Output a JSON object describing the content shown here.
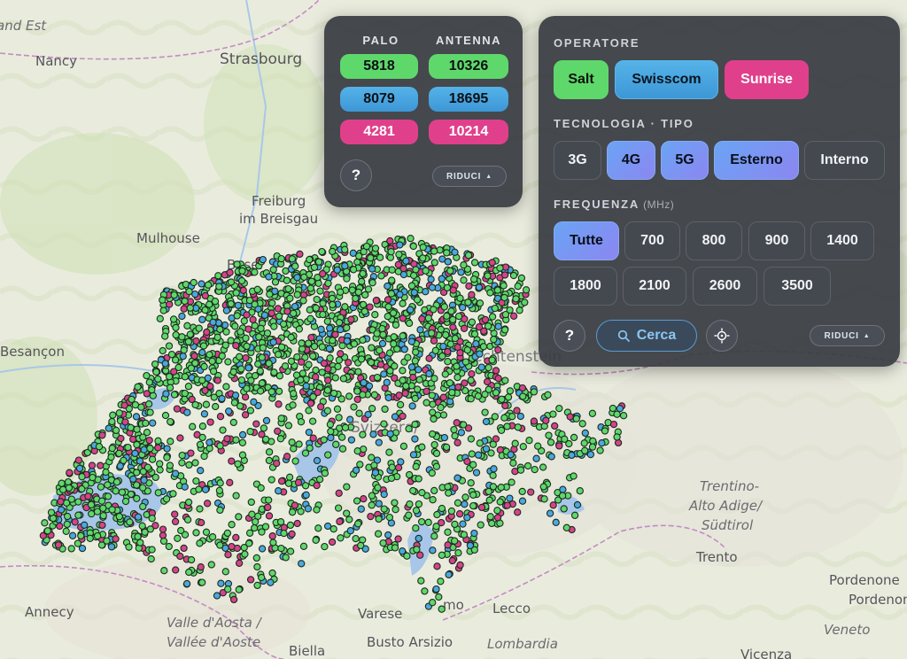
{
  "map": {
    "cities": [
      {
        "name": "and Est",
        "style": "normal"
      },
      {
        "name": "Nancy",
        "style": "normal"
      },
      {
        "name": "Strasbourg",
        "style": "normal"
      },
      {
        "name": "Freiburg",
        "style": "normal"
      },
      {
        "name": "im Breisgau",
        "style": "normal"
      },
      {
        "name": "Mulhouse",
        "style": "normal"
      },
      {
        "name": "Basel",
        "style": "normal"
      },
      {
        "name": "Besançon",
        "style": "normal"
      },
      {
        "name": "Liechtenstein",
        "style": "normal"
      },
      {
        "name": "Svizzera/",
        "style": "normal"
      },
      {
        "name": "Trentino-",
        "style": "italic"
      },
      {
        "name": "Alto Adige/",
        "style": "italic"
      },
      {
        "name": "Südtirol",
        "style": "italic"
      },
      {
        "name": "Trento",
        "style": "normal"
      },
      {
        "name": "Pordenone",
        "style": "normal"
      },
      {
        "name": "Pordenon",
        "style": "normal"
      },
      {
        "name": "Annecy",
        "style": "normal"
      },
      {
        "name": "Valle d'Aosta /",
        "style": "italic"
      },
      {
        "name": "Vallée d'Aoste",
        "style": "italic"
      },
      {
        "name": "Varese",
        "style": "normal"
      },
      {
        "name": "Lecco",
        "style": "normal"
      },
      {
        "name": "mo",
        "style": "normal"
      },
      {
        "name": "Busto Arsizio",
        "style": "normal"
      },
      {
        "name": "Lombardia",
        "style": "italic"
      },
      {
        "name": "Biella",
        "style": "normal"
      },
      {
        "name": "Veneto",
        "style": "italic"
      },
      {
        "name": "Vicenza",
        "style": "normal"
      }
    ],
    "marker_colors": {
      "salt": "#5fd86b",
      "swisscom": "#4aa8e0",
      "sunrise": "#d6438a"
    }
  },
  "counts": {
    "headers": {
      "palo": "PALO",
      "antenna": "ANTENNA"
    },
    "rows": [
      {
        "operator": "Salt",
        "color": "#5fd86b",
        "palo": "5818",
        "antenna": "10326"
      },
      {
        "operator": "Swisscom",
        "color": "#4aa8e0",
        "palo": "8079",
        "antenna": "18695"
      },
      {
        "operator": "Sunrise",
        "color": "#e0408b",
        "palo": "4281",
        "antenna": "10214"
      }
    ],
    "help_label": "?",
    "collapse_label": "RIDUCI",
    "collapse_icon": "triangle-up-icon"
  },
  "filters": {
    "operator_title": "OPERATORE",
    "operators": [
      {
        "label": "Salt",
        "selected": true
      },
      {
        "label": "Swisscom",
        "selected": true
      },
      {
        "label": "Sunrise",
        "selected": true
      }
    ],
    "tech_title": "TECNOLOGIA · TIPO",
    "tech": [
      {
        "label": "3G",
        "selected": false
      },
      {
        "label": "4G",
        "selected": true
      },
      {
        "label": "5G",
        "selected": true
      },
      {
        "label": "Esterno",
        "selected": true
      },
      {
        "label": "Interno",
        "selected": false
      }
    ],
    "freq_title": "FREQUENZA",
    "freq_unit": "(MHz)",
    "frequencies": [
      {
        "label": "Tutte",
        "selected": true
      },
      {
        "label": "700",
        "selected": false
      },
      {
        "label": "800",
        "selected": false
      },
      {
        "label": "900",
        "selected": false
      },
      {
        "label": "1400",
        "selected": false
      },
      {
        "label": "1800",
        "selected": false
      },
      {
        "label": "2100",
        "selected": false
      },
      {
        "label": "2600",
        "selected": false
      },
      {
        "label": "3500",
        "selected": false
      }
    ],
    "help_label": "?",
    "search_label": "Cerca",
    "search_icon": "search-icon",
    "locate_icon": "crosshair-icon",
    "collapse_label": "RIDUCI",
    "collapse_icon": "triangle-up-icon"
  }
}
